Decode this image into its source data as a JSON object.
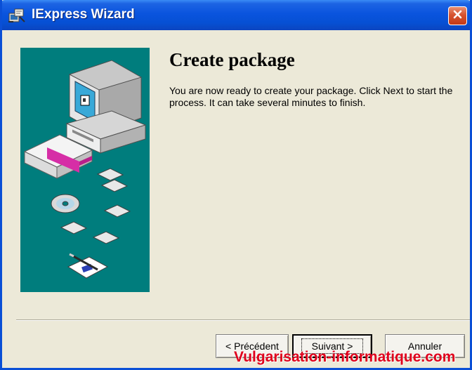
{
  "window": {
    "title": "IExpress Wizard",
    "title_icon": "iexpress-app-icon",
    "close_icon": "close-x-icon"
  },
  "page": {
    "heading": "Create package",
    "description": "You are now ready to create your package.  Click Next to start the process.  It can take several minutes to finish."
  },
  "buttons": {
    "back_label": "< Précédent",
    "next_label": "Suivant >",
    "cancel_label": "Annuler"
  },
  "watermark": "Vulgarisation-informatique.com",
  "colors": {
    "titlebar": "#0a54de",
    "window_bg": "#ece9d8",
    "illustration_bg": "#007d7d",
    "close_button": "#d6532f",
    "watermark": "#e0001c"
  }
}
